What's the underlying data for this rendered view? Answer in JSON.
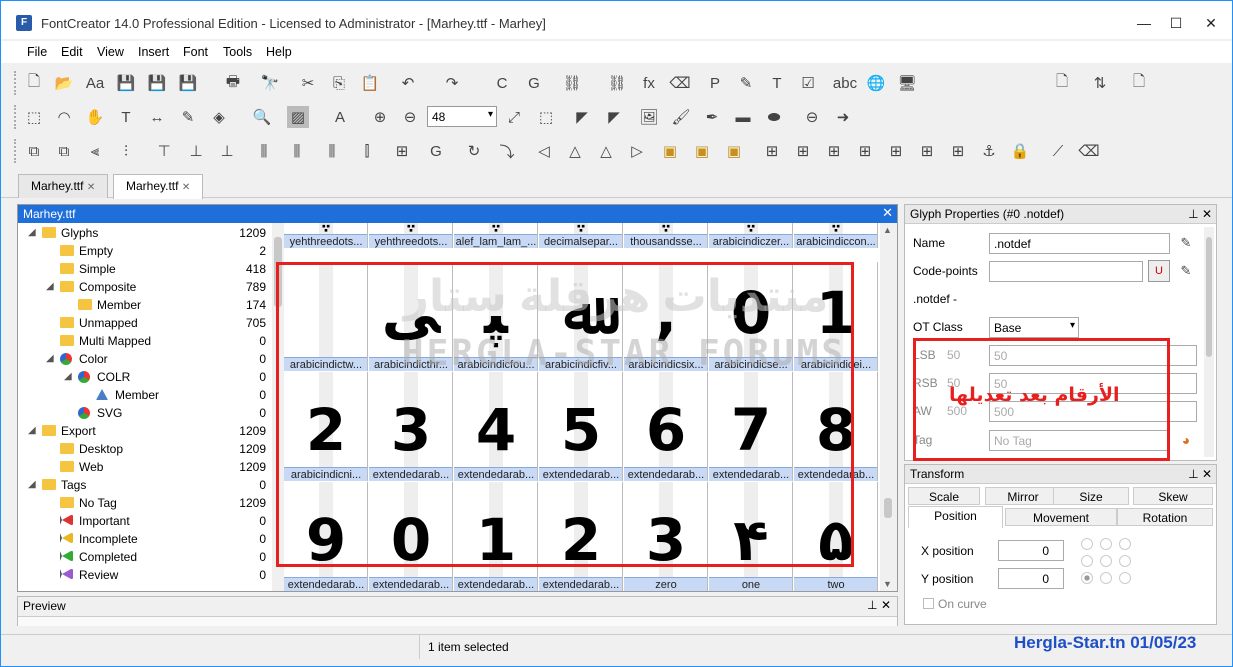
{
  "window": {
    "title": "FontCreator 14.0 Professional Edition - Licensed to Administrator - [Marhey.ttf - Marhey]",
    "minimize": "—",
    "maximize": "☐",
    "close": "✕"
  },
  "menu": [
    "File",
    "Edit",
    "View",
    "Insert",
    "Font",
    "Tools",
    "Help"
  ],
  "toolbar": {
    "zoom_value": "48"
  },
  "tabs": [
    {
      "label": "Marhey.ttf",
      "close": "✕"
    },
    {
      "label": "Marhey.ttf",
      "close": "✕"
    }
  ],
  "docpane": {
    "title": "Marhey.ttf",
    "close": "✕"
  },
  "tree": [
    {
      "label": "Glyphs",
      "count": "1209",
      "indent": 0,
      "exp": "◢",
      "icon": "folder"
    },
    {
      "label": "Empty",
      "count": "2",
      "indent": 1,
      "exp": "",
      "icon": "folder"
    },
    {
      "label": "Simple",
      "count": "418",
      "indent": 1,
      "exp": "",
      "icon": "folder"
    },
    {
      "label": "Composite",
      "count": "789",
      "indent": 1,
      "exp": "◢",
      "icon": "folder"
    },
    {
      "label": "Member",
      "count": "174",
      "indent": 2,
      "exp": "",
      "icon": "folder"
    },
    {
      "label": "Unmapped",
      "count": "705",
      "indent": 1,
      "exp": "",
      "icon": "folder"
    },
    {
      "label": "Multi Mapped",
      "count": "0",
      "indent": 1,
      "exp": "",
      "icon": "folder"
    },
    {
      "label": "Color",
      "count": "0",
      "indent": 1,
      "exp": "◢",
      "icon": "color"
    },
    {
      "label": "COLR",
      "count": "0",
      "indent": 2,
      "exp": "◢",
      "icon": "color"
    },
    {
      "label": "Member",
      "count": "0",
      "indent": 3,
      "exp": "",
      "icon": "triangle"
    },
    {
      "label": "SVG",
      "count": "0",
      "indent": 2,
      "exp": "",
      "icon": "color"
    },
    {
      "label": "Export",
      "count": "1209",
      "indent": 0,
      "exp": "◢",
      "icon": "folder"
    },
    {
      "label": "Desktop",
      "count": "1209",
      "indent": 1,
      "exp": "",
      "icon": "folder"
    },
    {
      "label": "Web",
      "count": "1209",
      "indent": 1,
      "exp": "",
      "icon": "folder"
    },
    {
      "label": "Tags",
      "count": "0",
      "indent": 0,
      "exp": "◢",
      "icon": "folder"
    },
    {
      "label": "No Tag",
      "count": "1209",
      "indent": 1,
      "exp": "",
      "icon": "folder"
    },
    {
      "label": "Important",
      "count": "0",
      "indent": 1,
      "exp": "",
      "icon": "flag-red"
    },
    {
      "label": "Incomplete",
      "count": "0",
      "indent": 1,
      "exp": "",
      "icon": "flag-yellow"
    },
    {
      "label": "Completed",
      "count": "0",
      "indent": 1,
      "exp": "",
      "icon": "flag-green"
    },
    {
      "label": "Review",
      "count": "0",
      "indent": 1,
      "exp": "",
      "icon": "flag-purple"
    }
  ],
  "grid": {
    "row0": {
      "glyphs": [
        "ﭙ",
        "ﭙ",
        "ﭙ",
        "ﭙ",
        "ﭙ",
        "ﭙ",
        "ﭙ"
      ],
      "labels": [
        "yehthreedots...",
        "yehthreedots...",
        "alef_lam_lam_...",
        "decimalsepar...",
        "thousandsse...",
        "arabicindiczer...",
        "arabicindiccon..."
      ]
    },
    "row1": {
      "glyphs": [
        "ﯽ",
        "ﭙ",
        "ﷲ",
        ",",
        "0",
        "1"
      ],
      "labels": [
        "arabicindictw...",
        "arabicindicthr...",
        "arabicindicfou...",
        "arabicindicfiv...",
        "arabicindicsix...",
        "arabicindicse...",
        "arabicindicei..."
      ]
    },
    "row2": {
      "glyphs": [
        "2",
        "3",
        "4",
        "5",
        "6",
        "7",
        "8"
      ],
      "labels": [
        "arabicindicni...",
        "extendedarab...",
        "extendedarab...",
        "extendedarab...",
        "extendedarab...",
        "extendedarab...",
        "extendedarab..."
      ]
    },
    "row3": {
      "glyphs": [
        "9",
        "0",
        "1",
        "2",
        "3",
        "۴",
        "۵"
      ],
      "labels": [
        "extendedarab...",
        "extendedarab...",
        "extendedarab...",
        "extendedarab...",
        "zero",
        "one",
        "two"
      ]
    }
  },
  "watermark": {
    "line1": "منتديات هرقلة ستار",
    "line2": "HERGLA-STAR FORUMS"
  },
  "glyph_properties": {
    "title": "Glyph Properties (#0 .notdef)",
    "name_label": "Name",
    "name_value": ".notdef",
    "codepoints_label": "Code-points",
    "codepoints_value": "",
    "desc": ".notdef -",
    "otclass_label": "OT Class",
    "otclass_value": "Base",
    "lsb_label": "LSB",
    "lsb_value": "50",
    "rsb_label": "RSB",
    "rsb_value": "50",
    "aw_label": "AW",
    "aw_value": "500",
    "tag_label": "Tag",
    "tag_value": "No Tag"
  },
  "transform": {
    "title": "Transform",
    "tabs_top": [
      "Scale",
      "Mirror",
      "Size",
      "Skew"
    ],
    "tabs_bottom": [
      "Position",
      "Movement",
      "Rotation"
    ],
    "x_label": "X position",
    "x_value": "0",
    "y_label": "Y position",
    "y_value": "0",
    "oncurve_label": "On curve"
  },
  "preview": {
    "title": "Preview"
  },
  "status": {
    "text": "1 item selected"
  },
  "annotation": "الأرقام بعد تعديلها",
  "footer": "Hergla-Star.tn  01/05/23",
  "colors": {
    "accent": "#1e6fd9",
    "annotation_red": "#e81f1f",
    "footer_blue": "#1e4fc8"
  }
}
